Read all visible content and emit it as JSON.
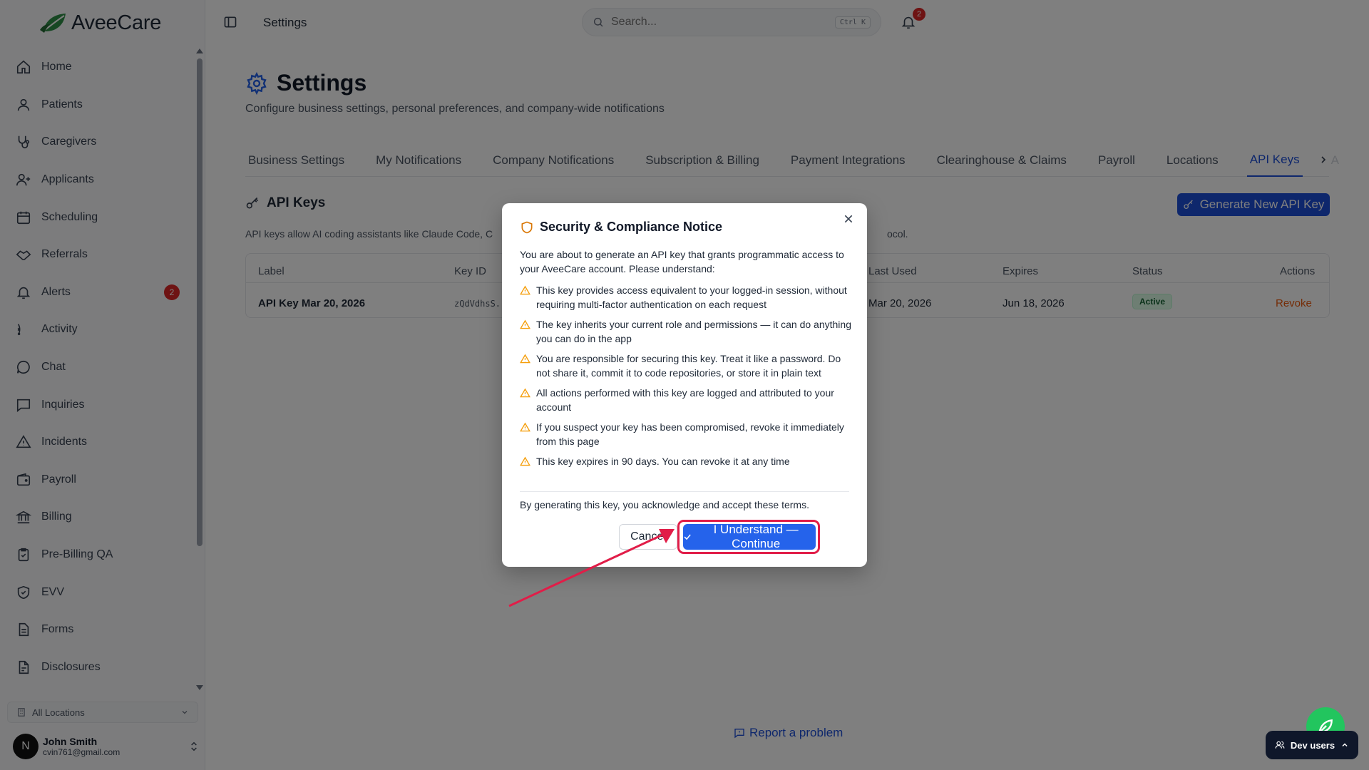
{
  "app": {
    "name": "AveeCare"
  },
  "sidebar": {
    "items": [
      {
        "label": "Home",
        "icon": "home-icon"
      },
      {
        "label": "Patients",
        "icon": "user-icon"
      },
      {
        "label": "Caregivers",
        "icon": "stethoscope-icon"
      },
      {
        "label": "Applicants",
        "icon": "user-plus-icon"
      },
      {
        "label": "Scheduling",
        "icon": "calendar-icon"
      },
      {
        "label": "Referrals",
        "icon": "handshake-icon"
      },
      {
        "label": "Alerts",
        "icon": "bell-icon",
        "badge": "2"
      },
      {
        "label": "Activity",
        "icon": "activity-icon"
      },
      {
        "label": "Chat",
        "icon": "chat-icon"
      },
      {
        "label": "Inquiries",
        "icon": "message-square-icon"
      },
      {
        "label": "Incidents",
        "icon": "alert-triangle-icon"
      },
      {
        "label": "Payroll",
        "icon": "wallet-icon"
      },
      {
        "label": "Billing",
        "icon": "landmark-icon"
      },
      {
        "label": "Pre-Billing QA",
        "icon": "clipboard-check-icon"
      },
      {
        "label": "EVV",
        "icon": "shield-check-icon"
      },
      {
        "label": "Forms",
        "icon": "file-text-icon"
      },
      {
        "label": "Disclosures",
        "icon": "file-icon"
      }
    ],
    "location_select": "All Locations",
    "user": {
      "initial": "N",
      "name": "John Smith",
      "email": "cvin761@gmail.com"
    }
  },
  "header": {
    "title": "Settings",
    "search_placeholder": "Search...",
    "search_shortcut": "Ctrl K",
    "notification_count": "2"
  },
  "page": {
    "title": "Settings",
    "subtitle": "Configure business settings, personal preferences, and company-wide notifications",
    "tabs": [
      {
        "label": "Business Settings"
      },
      {
        "label": "My Notifications"
      },
      {
        "label": "Company Notifications"
      },
      {
        "label": "Subscription & Billing"
      },
      {
        "label": "Payment Integrations"
      },
      {
        "label": "Clearinghouse & Claims"
      },
      {
        "label": "Payroll"
      },
      {
        "label": "Locations"
      },
      {
        "label": "API Keys",
        "active": true
      },
      {
        "label": "A"
      }
    ],
    "section_title": "API Keys",
    "generate_button": "Generate New API Key",
    "description_left": "API keys allow AI coding assistants like Claude Code, C",
    "description_right": "ocol.",
    "table": {
      "headers": [
        "Label",
        "Key ID",
        "Last Used",
        "Expires",
        "Status",
        "Actions"
      ],
      "rows": [
        {
          "label": "API Key Mar 20, 2026",
          "key_id": "zQdVdhsS...",
          "last_used": "Mar 20, 2026",
          "expires": "Jun 18, 2026",
          "status": "Active",
          "action": "Revoke"
        }
      ]
    },
    "report_link": "Report a problem"
  },
  "modal": {
    "title": "Security & Compliance Notice",
    "intro": "You are about to generate an API key that grants programmatic access to your AveeCare account. Please understand:",
    "bullets": [
      "This key provides access equivalent to your logged-in session, without requiring multi-factor authentication on each request",
      "The key inherits your current role and permissions — it can do anything you can do in the app",
      "You are responsible for securing this key. Treat it like a password. Do not share it, commit it to code repositories, or store it in plain text",
      "All actions performed with this key are logged and attributed to your account",
      "If you suspect your key has been compromised, revoke it immediately from this page",
      "This key expires in 90 days. You can revoke it at any time"
    ],
    "acknowledgement": "By generating this key, you acknowledge and accept these terms.",
    "cancel_label": "Cancel",
    "confirm_label": "I Understand — Continue"
  },
  "floating": {
    "dev_users_label": "Dev users"
  },
  "colors": {
    "accent": "#1d4ed8",
    "confirm": "#2563eb",
    "highlight": "#e11d48",
    "warning": "#f59e0b",
    "revoke": "#ea580c"
  }
}
